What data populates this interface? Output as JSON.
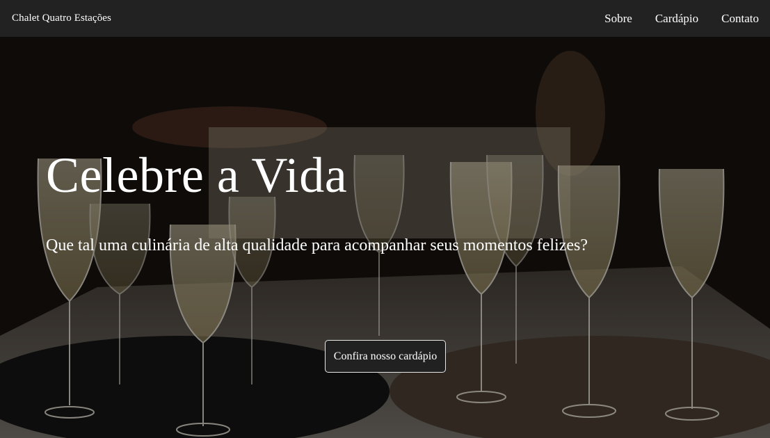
{
  "navbar": {
    "brand": "Chalet Quatro Estações",
    "links": [
      {
        "label": "Sobre"
      },
      {
        "label": "Cardápio"
      },
      {
        "label": "Contato"
      }
    ]
  },
  "hero": {
    "title": "Celebre a Vida",
    "subtitle": "Que tal uma culinária de alta qualidade para acompanhar seus momentos felizes?",
    "cta_label": "Confira nosso cardápio",
    "background": "champagne-glasses-photo"
  }
}
